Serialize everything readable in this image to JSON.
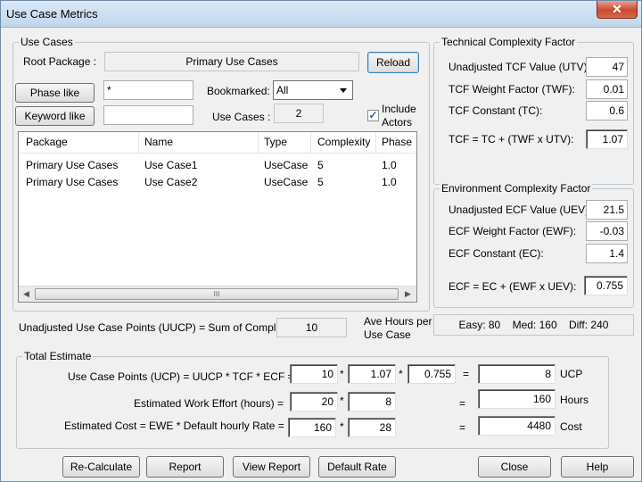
{
  "window": {
    "title": "Use Case Metrics",
    "close_glyph": "✕"
  },
  "use_cases": {
    "group_title": "Use Cases",
    "root_package_label": "Root Package :",
    "root_package_value": "Primary Use Cases",
    "reload_label": "Reload",
    "phase_like_label": "Phase like",
    "phase_like_value": "*",
    "keyword_like_label": "Keyword like",
    "keyword_like_value": "",
    "bookmarked_label": "Bookmarked:",
    "bookmarked_value": "All",
    "use_cases_count_label": "Use Cases :",
    "use_cases_count": "2",
    "include_actors_label_1": "Include",
    "include_actors_label_2": "Actors",
    "include_actors_checked": "✓",
    "columns": [
      "Package",
      "Name",
      "Type",
      "Complexity",
      "Phase"
    ],
    "rows": [
      [
        "Primary Use Cases",
        "Use Case1",
        "UseCase",
        "5",
        "1.0"
      ],
      [
        "Primary Use Cases",
        "Use Case2",
        "UseCase",
        "5",
        "1.0"
      ]
    ],
    "scroll_left": "◀",
    "scroll_right": "▶",
    "scroll_grip": "III"
  },
  "uucp": {
    "label": "Unadjusted Use Case Points (UUCP) = Sum of Complexity",
    "value": "10"
  },
  "ave_hours": {
    "label_1": "Ave Hours per",
    "label_2": "Use Case",
    "easy": "Easy: 80",
    "med": "Med: 160",
    "diff": "Diff: 240"
  },
  "tcf": {
    "group_title": "Technical Complexity Factor",
    "utv_label": "Unadjusted TCF Value (UTV):",
    "utv_value": "47",
    "twf_label": "TCF Weight Factor (TWF):",
    "twf_value": "0.01",
    "tc_label": "TCF Constant (TC):",
    "tc_value": "0.6",
    "formula_label": "TCF = TC + (TWF x UTV):",
    "result": "1.07"
  },
  "ecf": {
    "group_title": "Environment Complexity Factor",
    "uev_label": "Unadjusted ECF Value (UEV):",
    "uev_value": "21.5",
    "ewf_label": "ECF Weight Factor (EWF):",
    "ewf_value": "-0.03",
    "ec_label": "ECF Constant (EC):",
    "ec_value": "1.4",
    "formula_label": "ECF  = EC + (EWF x UEV):",
    "result": "0.755"
  },
  "total": {
    "group_title": "Total Estimate",
    "ucp_label": "Use Case Points (UCP) = UUCP * TCF * ECF =",
    "ucp_a": "10",
    "ucp_b": "1.07",
    "ucp_c": "0.755",
    "ucp_result": "8",
    "ucp_unit": "UCP",
    "effort_label": "Estimated Work Effort (hours) =",
    "effort_a": "20",
    "effort_b": "8",
    "effort_result": "160",
    "effort_unit": "Hours",
    "cost_label": "Estimated Cost  = EWE * Default hourly Rate =",
    "cost_a": "160",
    "cost_b": "28",
    "cost_result": "4480",
    "cost_unit": "Cost",
    "times": "*",
    "equals": "="
  },
  "buttons": {
    "recalculate": "Re-Calculate",
    "report": "Report",
    "view_report": "View Report",
    "default_rate": "Default Rate",
    "close": "Close",
    "help": "Help"
  }
}
